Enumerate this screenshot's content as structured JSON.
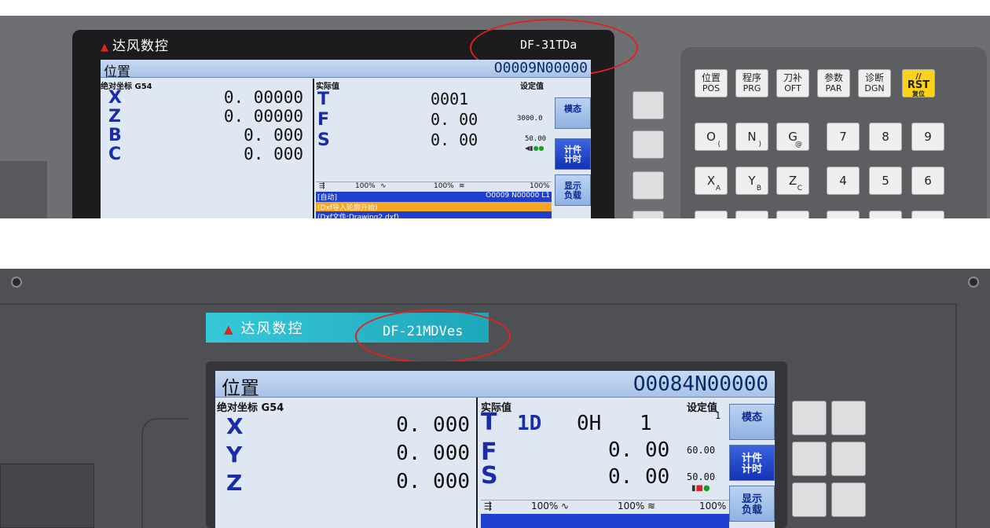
{
  "panel1": {
    "brand": "达风数控",
    "model": "DF-31TDa",
    "title": "位置",
    "prog_no": "O0009N00000",
    "coord_header": "绝对坐标 G54",
    "axes": [
      {
        "name": "X",
        "value": "0. 00000"
      },
      {
        "name": "Z",
        "value": "0. 00000"
      },
      {
        "name": "B",
        "value": "0. 000"
      },
      {
        "name": "C",
        "value": "0. 000"
      }
    ],
    "actual_header": "实际值",
    "set_header": "设定值",
    "t_label": "T",
    "t_value": "0001",
    "f_label": "F",
    "f_value": "0. 00",
    "f_set": "3000.0",
    "s_label": "S",
    "s_value": "0. 00",
    "s_set": "50.00",
    "rate_feed": "100%",
    "rate_rapid": "100%",
    "rate_spindle": "100%",
    "status_mode": "[自动]",
    "status_prog": "O0009 N00000 L1",
    "prog_line1": "(Dxf导入轮廓开始)",
    "prog_line2": "(Dxf文件:Drawing2.dxf)",
    "side_buttons": [
      "模态",
      "计件\n计时",
      "显示\n负载"
    ],
    "fn_keys": [
      {
        "cn": "位置",
        "en": "POS"
      },
      {
        "cn": "程序",
        "en": "PRG"
      },
      {
        "cn": "刀补",
        "en": "OFT"
      },
      {
        "cn": "参数",
        "en": "PAR"
      },
      {
        "cn": "诊断",
        "en": "DGN"
      }
    ],
    "rst_key": {
      "top": "//",
      "main": "RST",
      "sub": "复位"
    },
    "row2": [
      {
        "main": "O",
        "sub": "("
      },
      {
        "main": "N",
        "sub": ")"
      },
      {
        "main": "G",
        "sub": "@"
      },
      {
        "main": "7",
        "sub": ""
      },
      {
        "main": "8",
        "sub": ""
      },
      {
        "main": "9",
        "sub": ""
      }
    ],
    "row3": [
      {
        "main": "X",
        "sub": "A"
      },
      {
        "main": "Y",
        "sub": "B"
      },
      {
        "main": "Z",
        "sub": "C"
      },
      {
        "main": "4",
        "sub": ""
      },
      {
        "main": "5",
        "sub": ""
      },
      {
        "main": "6",
        "sub": ""
      }
    ]
  },
  "panel2": {
    "brand": "达风数控",
    "model": "DF-21MDVes",
    "title": "位置",
    "prog_no": "O0084N00000",
    "coord_header": "绝对坐标 G54",
    "axes": [
      {
        "name": "X",
        "value": "0. 000"
      },
      {
        "name": "Y",
        "value": "0. 000"
      },
      {
        "name": "Z",
        "value": "0. 000"
      }
    ],
    "actual_header": "实际值",
    "set_header": "设定值",
    "t_label": "T",
    "t_value": "1D",
    "h_value": "0H",
    "h_num": "1",
    "t_set": "1",
    "f_label": "F",
    "f_value": "0. 00",
    "f_set": "60.00",
    "s_label": "S",
    "s_value": "0. 00",
    "s_set": "50.00",
    "rate_feed": "100%",
    "rate_rapid": "100%",
    "rate_spindle": "100%",
    "side_buttons": [
      "模态",
      "计件\n计时",
      "显示\n负载"
    ]
  },
  "colors": {
    "axis_blue": "#1b2ca8",
    "status_blue": "#1f3fd1",
    "program_orange": "#f5a623",
    "rst_yellow": "#ffd21a",
    "annotation_red": "#e32020",
    "brand_cyan": "#35c8d8"
  }
}
